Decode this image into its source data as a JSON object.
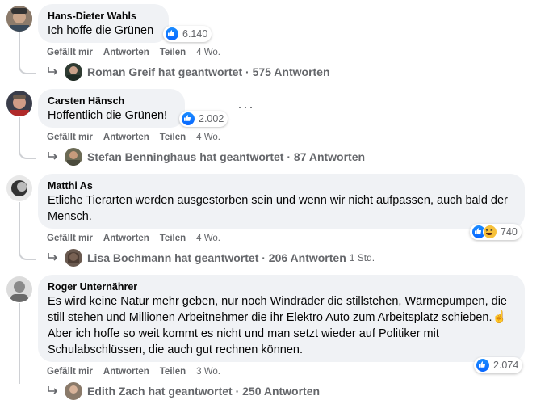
{
  "actions": {
    "like": "Gefällt mir",
    "reply": "Antworten",
    "share": "Teilen"
  },
  "comments": [
    {
      "author": "Hans-Dieter Wahls",
      "text": "Ich hoffe die Grünen",
      "reactions": {
        "icons": [
          "like-icon"
        ],
        "count": "6.140"
      },
      "time": "4 Wo.",
      "replies": {
        "name": "Roman Greif",
        "summary": "Roman Greif hat geantwortet · 575 Antworten",
        "time": ""
      }
    },
    {
      "author": "Carsten Hänsch",
      "text": "Hoffentlich die Grünen!",
      "reactions": {
        "icons": [
          "like-icon"
        ],
        "count": "2.002"
      },
      "time": "4 Wo.",
      "replies": {
        "name": "Stefan Benninghaus",
        "summary": "Stefan Benninghaus hat geantwortet · 87 Antworten",
        "time": ""
      }
    },
    {
      "author": "Matthi As",
      "text": "Etliche Tierarten werden ausgestorben sein und wenn wir nicht aufpassen, auch bald der Mensch.",
      "reactions": {
        "icons": [
          "like-icon",
          "haha-icon"
        ],
        "count": "740"
      },
      "time": "4 Wo.",
      "replies": {
        "name": "Lisa Bochmann",
        "summary": "Lisa Bochmann hat geantwortet · 206 Antworten",
        "time": "1 Std."
      }
    },
    {
      "author": "Roger Unternährer",
      "text": "Es wird keine Natur mehr geben, nur noch Windräder die stillstehen, Wärmepumpen, die still stehen und Millionen Arbeitnehmer die ihr Elektro Auto zum Arbeitsplatz schieben.☝️ Aber ich hoffe so weit kommt es nicht und man setzt wieder auf Politiker mit Schulabschlüssen, die auch gut rechnen können.",
      "reactions": {
        "icons": [
          "like-icon"
        ],
        "count": "2.074"
      },
      "time": "3 Wo.",
      "replies": {
        "name": "Edith Zach",
        "summary": "Edith Zach hat geantwortet · 250 Antworten",
        "time": ""
      }
    }
  ],
  "colors": {
    "bubble": "#f0f2f5",
    "like": "#0866ff",
    "secondary_text": "#65676b"
  }
}
